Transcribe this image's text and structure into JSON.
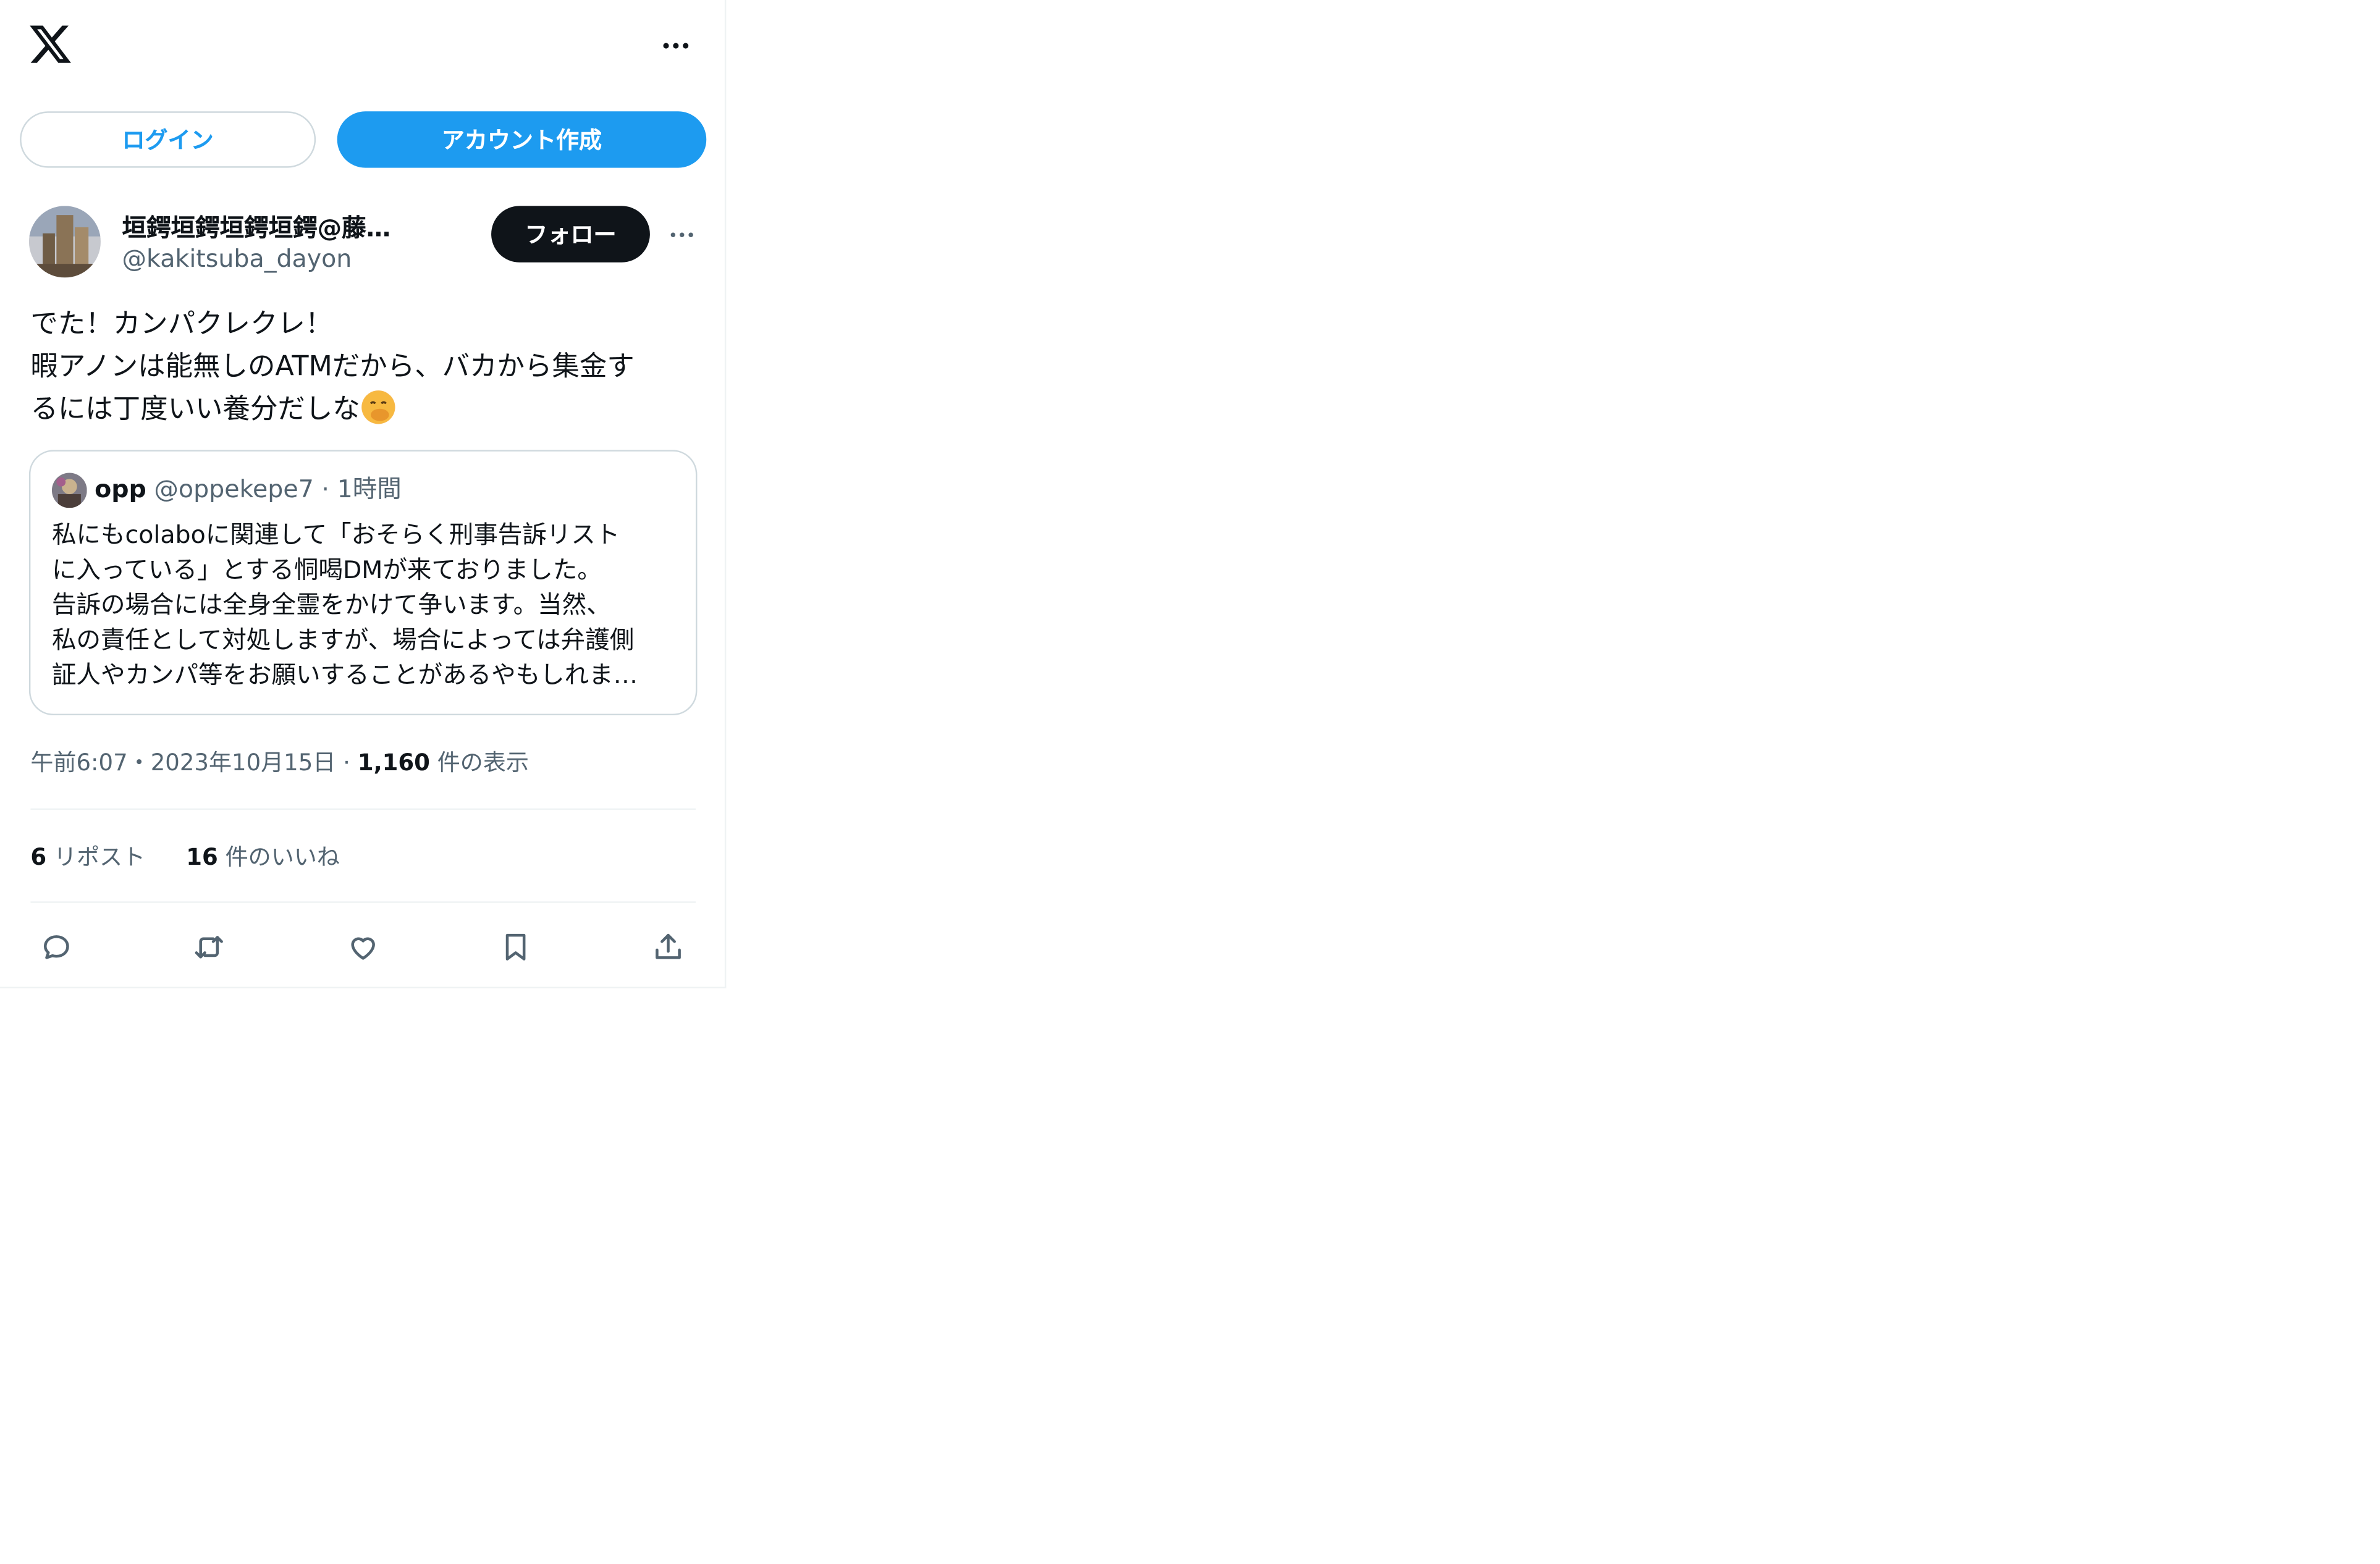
{
  "header": {
    "logo_icon": "x-logo-icon",
    "more_icon": "more-horizontal-icon"
  },
  "auth": {
    "login_label": "ログイン",
    "signup_label": "アカウント作成"
  },
  "tweet": {
    "author_name": "垣鍔垣鍔垣鍔垣鍔@藤…",
    "author_handle": "@kakitsuba_dayon",
    "follow_label": "フォロー",
    "body_lines": [
      "でた！カンパクレクレ！",
      "暇アノンは能無しのATMだから、バカから集金す",
      "るには丁度いい養分だしな"
    ],
    "emoji_icon": "face-with-hand-over-mouth-emoji",
    "quoted": {
      "name": "opp",
      "handle": "@oppekepe7",
      "separator": "·",
      "time": "1時間",
      "lines": [
        "私にもcolaboに関連して「おそらく刑事告訴リスト",
        "に入っている」とする恫喝DMが来ておりました。",
        "告訴の場合には全身全霊をかけて争います。当然、",
        "私の責任として対処しますが、場合によっては弁護側",
        "証人やカンパ等をお願いすることがあるやもしれま…"
      ]
    },
    "meta": {
      "time": "午前6:07",
      "sep1": "・",
      "date": "2023年10月15日",
      "sep2": "·",
      "views_count": "1,160",
      "views_label": "件の表示"
    },
    "stats": {
      "reposts_count": "6",
      "reposts_label": "リポスト",
      "likes_count": "16",
      "likes_label": "件のいいね"
    },
    "actions": [
      "reply-icon",
      "repost-icon",
      "like-icon",
      "bookmark-icon",
      "share-icon"
    ]
  },
  "colors": {
    "accent": "#1d9bf0",
    "text": "#0f1419",
    "secondary": "#536471",
    "border": "#cfd9de"
  }
}
